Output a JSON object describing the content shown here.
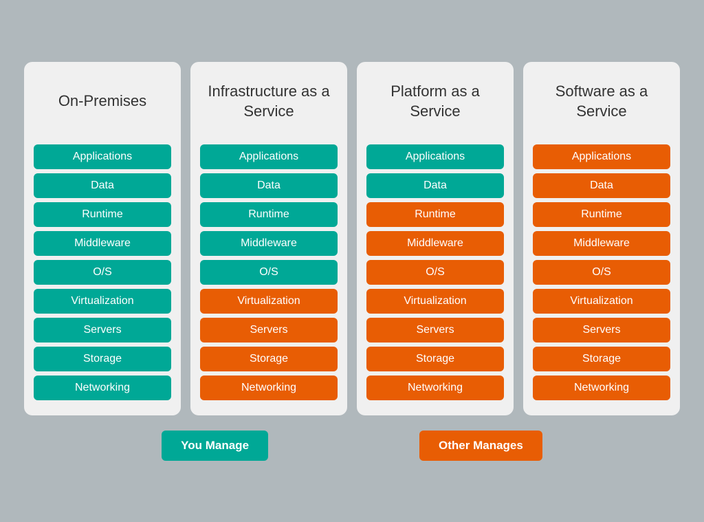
{
  "columns": [
    {
      "id": "on-premises",
      "title": "On-Premises",
      "items": [
        {
          "label": "Applications",
          "color": "teal"
        },
        {
          "label": "Data",
          "color": "teal"
        },
        {
          "label": "Runtime",
          "color": "teal"
        },
        {
          "label": "Middleware",
          "color": "teal"
        },
        {
          "label": "O/S",
          "color": "teal"
        },
        {
          "label": "Virtualization",
          "color": "teal"
        },
        {
          "label": "Servers",
          "color": "teal"
        },
        {
          "label": "Storage",
          "color": "teal"
        },
        {
          "label": "Networking",
          "color": "teal"
        }
      ]
    },
    {
      "id": "iaas",
      "title": "Infrastructure as a Service",
      "items": [
        {
          "label": "Applications",
          "color": "teal"
        },
        {
          "label": "Data",
          "color": "teal"
        },
        {
          "label": "Runtime",
          "color": "teal"
        },
        {
          "label": "Middleware",
          "color": "teal"
        },
        {
          "label": "O/S",
          "color": "teal"
        },
        {
          "label": "Virtualization",
          "color": "orange"
        },
        {
          "label": "Servers",
          "color": "orange"
        },
        {
          "label": "Storage",
          "color": "orange"
        },
        {
          "label": "Networking",
          "color": "orange"
        }
      ]
    },
    {
      "id": "paas",
      "title": "Platform as a Service",
      "items": [
        {
          "label": "Applications",
          "color": "teal"
        },
        {
          "label": "Data",
          "color": "teal"
        },
        {
          "label": "Runtime",
          "color": "orange"
        },
        {
          "label": "Middleware",
          "color": "orange"
        },
        {
          "label": "O/S",
          "color": "orange"
        },
        {
          "label": "Virtualization",
          "color": "orange"
        },
        {
          "label": "Servers",
          "color": "orange"
        },
        {
          "label": "Storage",
          "color": "orange"
        },
        {
          "label": "Networking",
          "color": "orange"
        }
      ]
    },
    {
      "id": "saas",
      "title": "Software as a Service",
      "items": [
        {
          "label": "Applications",
          "color": "orange"
        },
        {
          "label": "Data",
          "color": "orange"
        },
        {
          "label": "Runtime",
          "color": "orange"
        },
        {
          "label": "Middleware",
          "color": "orange"
        },
        {
          "label": "O/S",
          "color": "orange"
        },
        {
          "label": "Virtualization",
          "color": "orange"
        },
        {
          "label": "Servers",
          "color": "orange"
        },
        {
          "label": "Storage",
          "color": "orange"
        },
        {
          "label": "Networking",
          "color": "orange"
        }
      ]
    }
  ],
  "legend": {
    "you_manage": "You Manage",
    "other_manages": "Other Manages"
  },
  "colors": {
    "teal": "#00a896",
    "orange": "#e85d04"
  }
}
